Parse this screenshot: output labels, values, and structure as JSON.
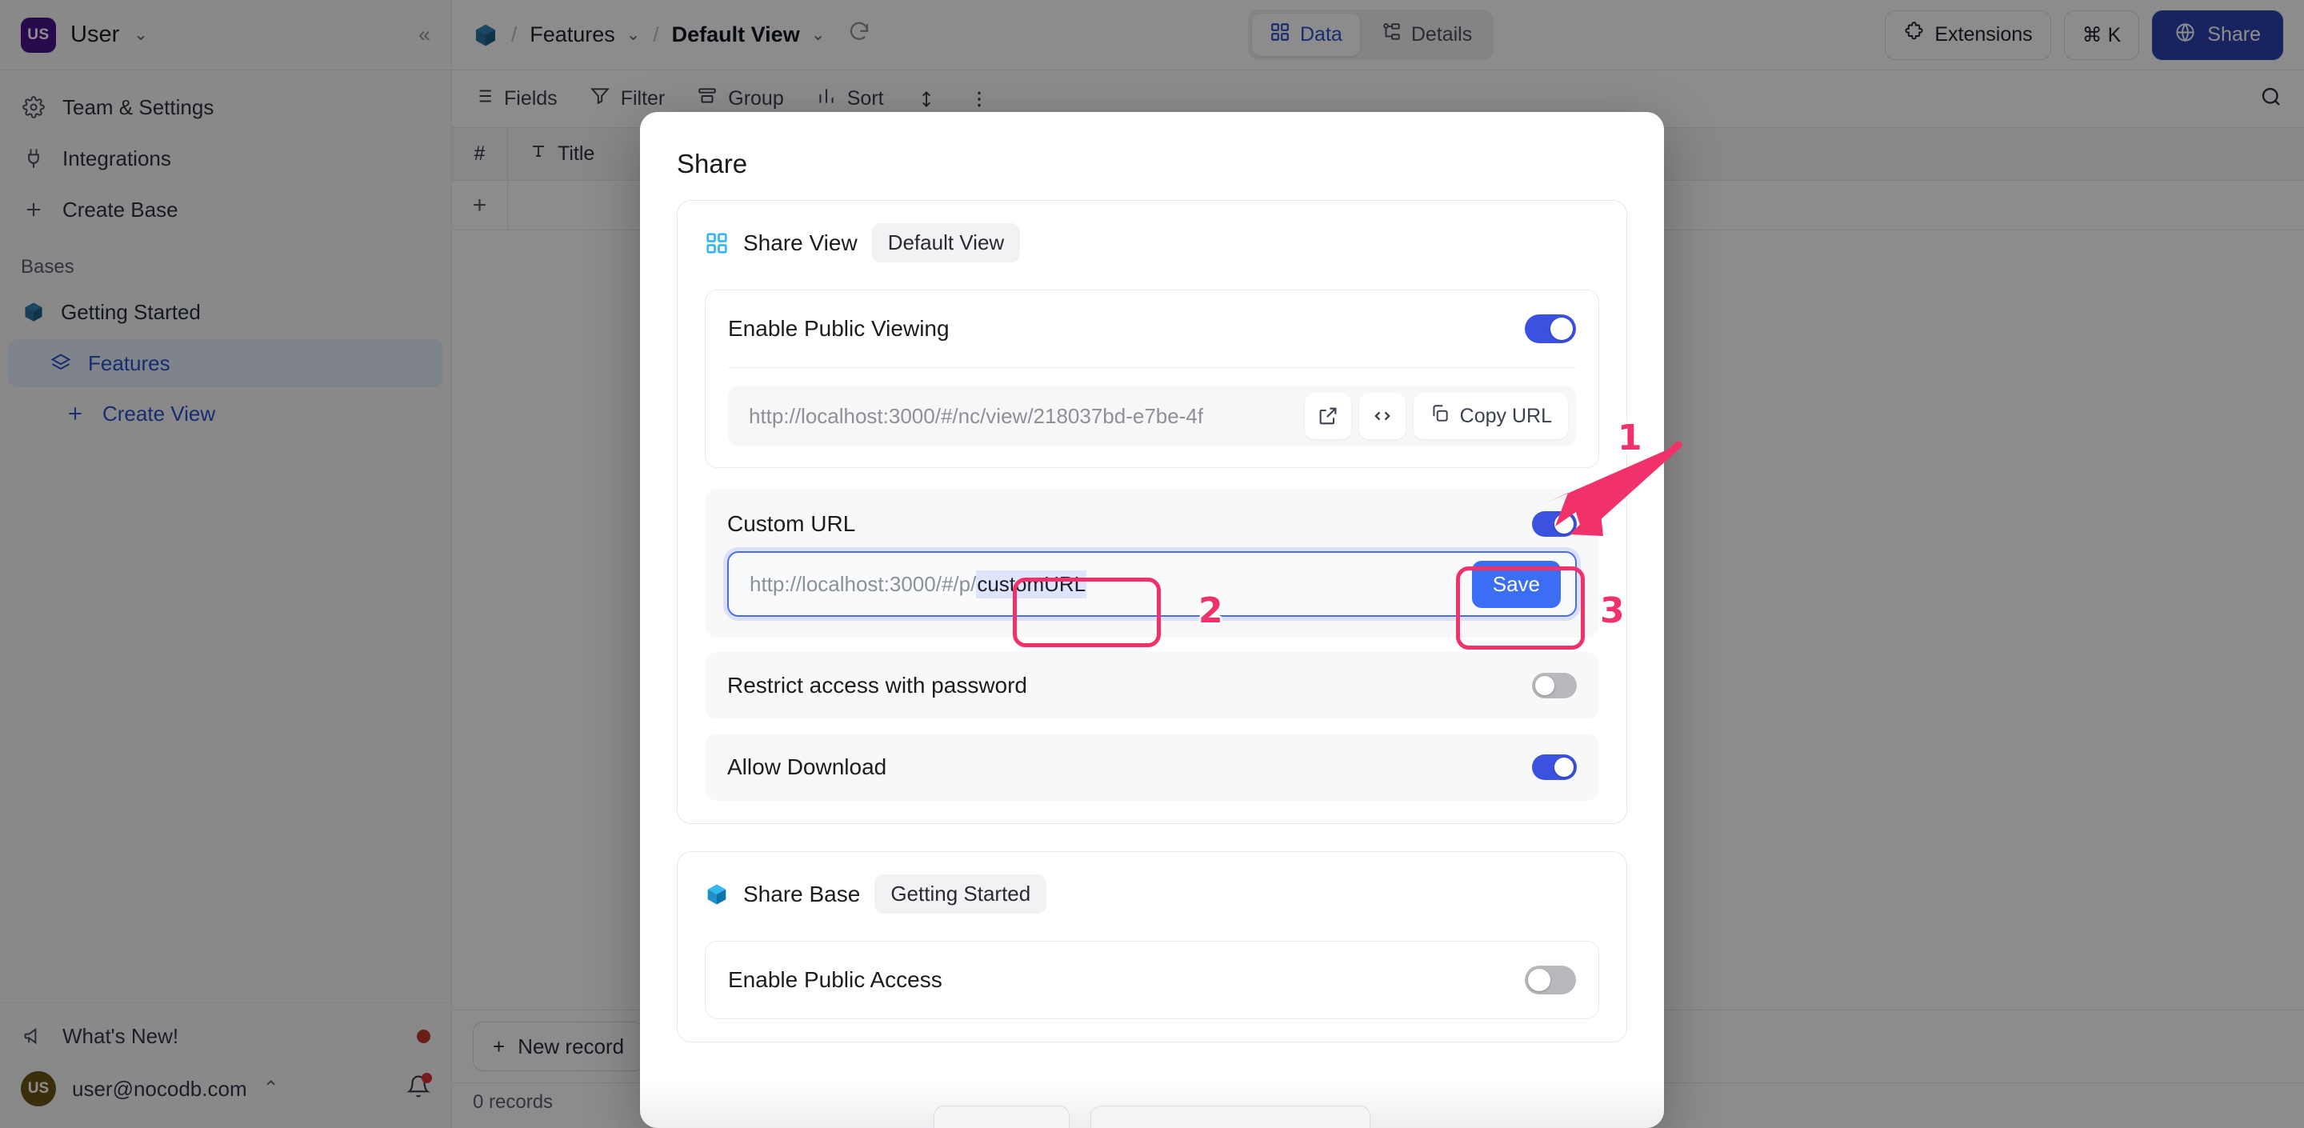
{
  "colors": {
    "accent_blue": "#2952cc",
    "primary_button": "#2b43b0",
    "toggle_on": "#3b52e0",
    "toggle_off": "#b9b9bd",
    "save_button": "#3b6ef5",
    "annotation_pink": "#f0316a",
    "avatar_purple": "#4a148c"
  },
  "sidebar": {
    "user": {
      "initials": "US",
      "name": "User"
    },
    "collapse_icon": "chevrons-left-icon",
    "nav": [
      {
        "label": "Team & Settings",
        "icon": "gear-icon"
      },
      {
        "label": "Integrations",
        "icon": "plug-icon"
      },
      {
        "label": "Create Base",
        "icon": "plus-icon"
      }
    ],
    "bases_label": "Bases",
    "base": {
      "label": "Getting Started",
      "icon": "base-cube-icon"
    },
    "table": {
      "label": "Features",
      "icon": "table-stack-icon"
    },
    "create_view": {
      "label": "Create View",
      "icon": "plus-icon"
    },
    "footer": {
      "whats_new": "What's New!",
      "account_email": "user@nocodb.com",
      "account_initials": "US",
      "bell_icon": "bell-icon",
      "megaphone_icon": "megaphone-icon",
      "chevron_up_icon": "chevron-up-icon"
    }
  },
  "topbar": {
    "base_icon": "base-cube-icon",
    "breadcrumb": {
      "table": "Features",
      "view": "Default View",
      "separator": "/"
    },
    "refresh_icon": "refresh-icon",
    "segments": [
      {
        "label": "Data",
        "icon": "grid-icon",
        "active": true
      },
      {
        "label": "Details",
        "icon": "schema-icon",
        "active": false
      }
    ],
    "extensions_label": "Extensions",
    "extensions_icon": "puzzle-icon",
    "command_label": "⌘ K",
    "share_label": "Share",
    "share_icon": "globe-icon"
  },
  "toolbar": {
    "items": [
      {
        "label": "Fields",
        "icon": "list-icon"
      },
      {
        "label": "Filter",
        "icon": "funnel-icon"
      },
      {
        "label": "Group",
        "icon": "group-icon"
      },
      {
        "label": "Sort",
        "icon": "sort-icon"
      }
    ],
    "row_height_icon": "row-height-icon",
    "more_icon": "more-vertical-icon",
    "search_icon": "search-icon"
  },
  "grid": {
    "columns": [
      {
        "label": "#",
        "icon": "hash-icon"
      },
      {
        "label": "Title",
        "icon": "text-field-icon"
      }
    ],
    "add_row_icon": "plus-icon",
    "new_record_label": "New record",
    "new_record_icon": "plus-icon",
    "record_count": "0 records"
  },
  "modal": {
    "title": "Share",
    "share_view": {
      "icon": "grid-icon",
      "label": "Share View",
      "view_pill": "Default View",
      "enable_public_viewing": {
        "label": "Enable Public Viewing",
        "enabled": true
      },
      "public_url": "http://localhost:3000/#/nc/view/218037bd-e7be-4f",
      "url_actions": [
        {
          "icon": "external-link-icon",
          "label": ""
        },
        {
          "icon": "code-embed-icon",
          "label": ""
        },
        {
          "icon": "copy-icon",
          "label": "Copy URL"
        }
      ],
      "custom_url": {
        "label": "Custom URL",
        "enabled": true,
        "prefix": "http://localhost:3000/#/p/",
        "value": "customURL",
        "save_label": "Save"
      },
      "restrict_password": {
        "label": "Restrict access with password",
        "enabled": false
      },
      "allow_download": {
        "label": "Allow Download",
        "enabled": true
      }
    },
    "share_base": {
      "icon": "base-cube-icon",
      "label": "Share Base",
      "base_pill": "Getting Started",
      "enable_public_access": {
        "label": "Enable Public Access",
        "enabled": false
      }
    }
  },
  "annotations": [
    {
      "number": "1",
      "target": "custom-url-toggle"
    },
    {
      "number": "2",
      "target": "custom-url-value"
    },
    {
      "number": "3",
      "target": "save-button"
    }
  ]
}
